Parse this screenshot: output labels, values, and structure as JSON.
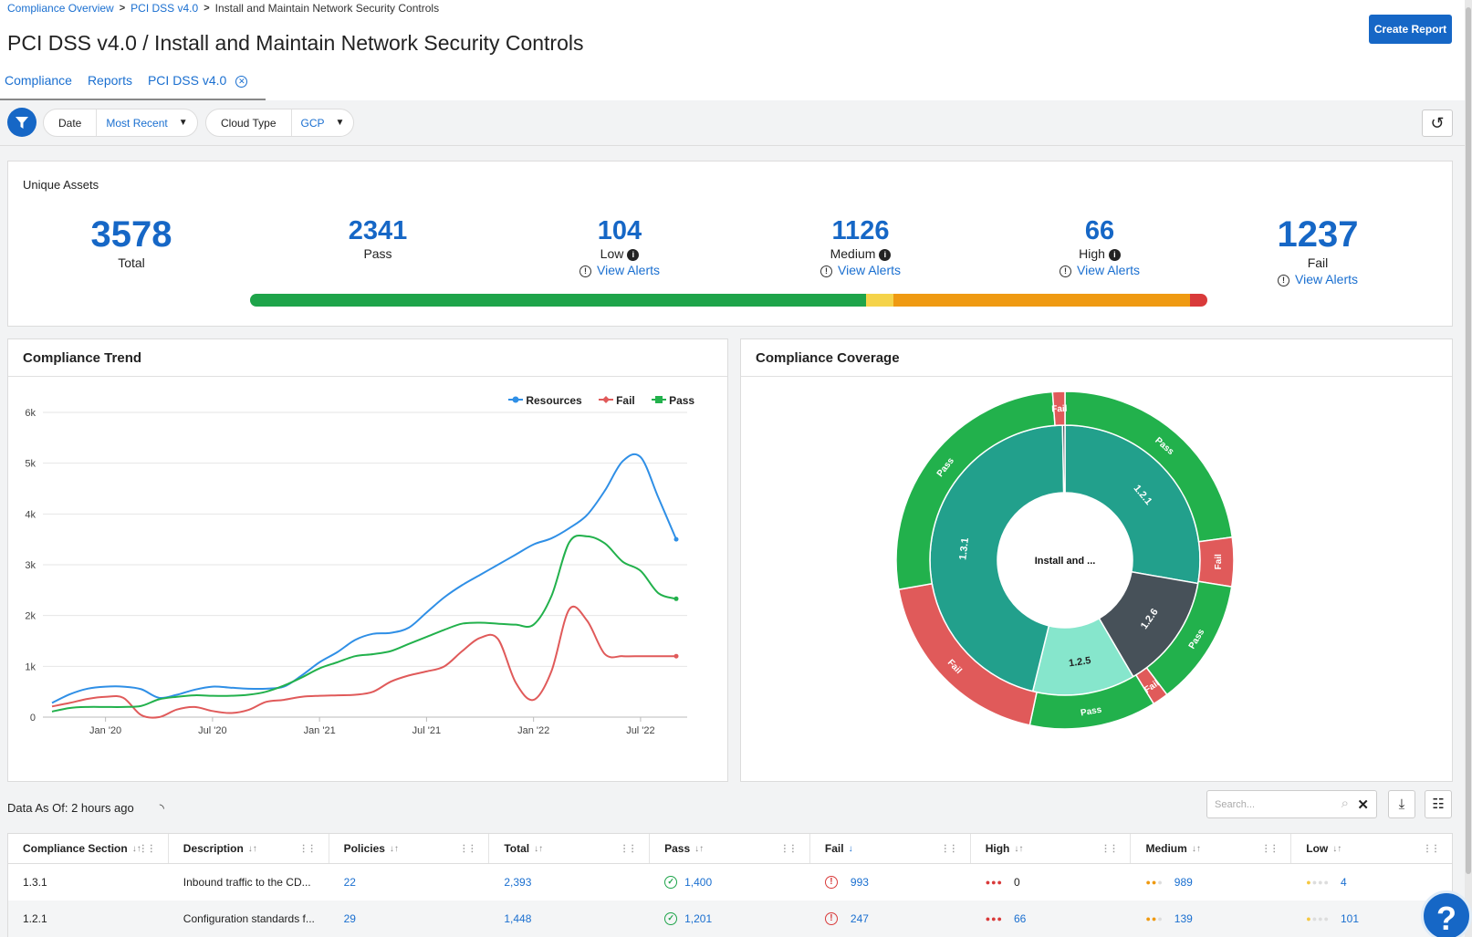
{
  "breadcrumb": {
    "items": [
      "Compliance Overview",
      "PCI DSS v4.0"
    ],
    "current": "Install and Maintain Network Security Controls"
  },
  "page_title": "PCI DSS v4.0 / Install and Maintain Network Security Controls",
  "create_report": "Create Report",
  "tabs": [
    "Compliance",
    "Reports",
    "PCI DSS v4.0"
  ],
  "filters": {
    "date_label": "Date",
    "date_value": "Most Recent",
    "cloud_label": "Cloud Type",
    "cloud_value": "GCP"
  },
  "assets": {
    "title": "Unique Assets",
    "total": "3578",
    "total_label": "Total",
    "pass": "2341",
    "pass_label": "Pass",
    "low": "104",
    "low_label": "Low",
    "medium": "1126",
    "medium_label": "Medium",
    "high": "66",
    "high_label": "High",
    "fail": "1237",
    "fail_label": "Fail",
    "view_alerts": "View Alerts",
    "bar": {
      "pass": 2341,
      "low": 104,
      "medium": 1126,
      "high": 66
    }
  },
  "colors": {
    "brand": "#1667c6",
    "pass": "#1ea44a",
    "low": "#f5d34a",
    "medium": "#ef9a12",
    "high": "#d93a3a",
    "resources": "#2f8fe6",
    "fail_line": "#e05a5a",
    "pass_line": "#22b14c"
  },
  "trend": {
    "title": "Compliance Trend"
  },
  "coverage": {
    "title": "Compliance Coverage",
    "center": "Install and ..."
  },
  "chart_data": [
    {
      "type": "line",
      "x": [
        "2019-10",
        "2019-11",
        "2019-12",
        "2020-01",
        "2020-02",
        "2020-03",
        "2020-04",
        "2020-05",
        "2020-06",
        "2020-07",
        "2020-08",
        "2020-09",
        "2020-10",
        "2020-11",
        "2020-12",
        "2021-01",
        "2021-02",
        "2021-03",
        "2021-04",
        "2021-05",
        "2021-06",
        "2021-07",
        "2021-08",
        "2021-09",
        "2021-10",
        "2021-11",
        "2021-12",
        "2022-01",
        "2022-02",
        "2022-03",
        "2022-04",
        "2022-05",
        "2022-06",
        "2022-07",
        "2022-08",
        "2022-09"
      ],
      "xticks": [
        "Jan '20",
        "Jul '20",
        "Jan '21",
        "Jul '21",
        "Jan '22",
        "Jul '22"
      ],
      "yticks": [
        "0",
        "1k",
        "2k",
        "3k",
        "4k",
        "5k",
        "6k"
      ],
      "ylim": [
        0,
        6000
      ],
      "legend": "top-right",
      "series": [
        {
          "name": "Resources",
          "values": [
            280,
            450,
            560,
            600,
            600,
            550,
            380,
            440,
            540,
            600,
            580,
            560,
            560,
            600,
            820,
            1080,
            1280,
            1520,
            1640,
            1660,
            1760,
            2060,
            2360,
            2600,
            2800,
            3000,
            3200,
            3400,
            3520,
            3720,
            3980,
            4460,
            5040,
            5120,
            4320,
            3500
          ]
        },
        {
          "name": "Fail",
          "values": [
            210,
            280,
            360,
            400,
            380,
            40,
            0,
            150,
            200,
            120,
            80,
            140,
            300,
            340,
            400,
            420,
            430,
            440,
            500,
            700,
            820,
            900,
            1000,
            1300,
            1560,
            1540,
            680,
            340,
            900,
            2120,
            1900,
            1240,
            1200,
            1200,
            1200,
            1200
          ]
        },
        {
          "name": "Pass",
          "values": [
            110,
            180,
            200,
            200,
            200,
            220,
            350,
            400,
            430,
            420,
            420,
            440,
            500,
            620,
            780,
            960,
            1080,
            1200,
            1240,
            1300,
            1440,
            1580,
            1720,
            1840,
            1860,
            1840,
            1820,
            1820,
            2380,
            3440,
            3560,
            3420,
            3060,
            2880,
            2440,
            2330
          ]
        }
      ]
    },
    {
      "type": "pie",
      "center": "Install and ...",
      "inner": [
        {
          "label": "1.2.1",
          "value": 1448
        },
        {
          "label": "1.2.6",
          "value": 720
        },
        {
          "label": "1.2.5",
          "value": 640
        },
        {
          "label": "1.3.1",
          "value": 2393
        },
        {
          "label": "",
          "value": 15
        }
      ],
      "outer": [
        {
          "label": "Pass",
          "value": 1201,
          "color": "#22b14c"
        },
        {
          "label": "Fail",
          "value": 247,
          "color": "#e05a5a"
        },
        {
          "label": "Pass",
          "value": 640,
          "color": "#22b14c"
        },
        {
          "label": "Fail",
          "value": 80,
          "color": "#e05a5a"
        },
        {
          "label": "Pass",
          "value": 640,
          "color": "#22b14c"
        },
        {
          "label": "Fail",
          "value": 993,
          "color": "#e05a5a"
        },
        {
          "label": "Pass",
          "value": 1400,
          "color": "#22b14c"
        },
        {
          "label": "Fail",
          "value": 62,
          "color": "#e05a5a"
        }
      ]
    }
  ],
  "data_as_of": "Data As Of: 2 hours ago",
  "search_placeholder": "Search...",
  "table": {
    "headers": [
      "Compliance Section",
      "Description",
      "Policies",
      "Total",
      "Pass",
      "Fail",
      "High",
      "Medium",
      "Low"
    ],
    "rows": [
      {
        "section": "1.3.1",
        "description": "Inbound traffic to the CD...",
        "policies": "22",
        "total": "2,393",
        "pass": "1,400",
        "fail": "993",
        "high": "0",
        "medium": "989",
        "low": "4"
      },
      {
        "section": "1.2.1",
        "description": "Configuration standards f...",
        "policies": "29",
        "total": "1,448",
        "pass": "1,201",
        "fail": "247",
        "high": "66",
        "medium": "139",
        "low": "101"
      }
    ]
  }
}
